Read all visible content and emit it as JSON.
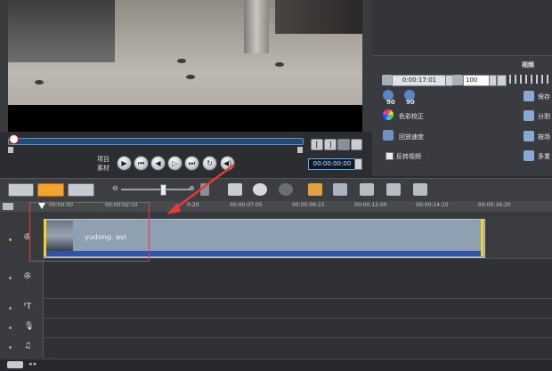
{
  "preview": {
    "label_project": "项目",
    "label_clip": "素材",
    "timecode": "00:00:00:00",
    "buttons": [
      "play-icon",
      "to-start-icon",
      "prev-frame-icon",
      "next-frame-icon",
      "to-end-icon",
      "repeat-icon",
      "volume-icon"
    ],
    "trim_buttons": [
      "[",
      "]"
    ]
  },
  "options_panel": {
    "tab_video": "视频",
    "duration": "0:00:17:01",
    "volume": "100",
    "rotate_left_label": "90",
    "rotate_right_label": "90",
    "color_correction": "色彩校正",
    "playback_speed": "回放速度",
    "reverse_video": "反转视频",
    "save": "保存",
    "split": "分割",
    "scan": "按场",
    "multi": "多重"
  },
  "timeline": {
    "ruler_ticks": [
      "00:00:00:00",
      "00:00:02:10",
      "00:00:04:20",
      "00:00:07:05",
      "00:00:09:15",
      "00:00:12:00",
      "00:00:14:10",
      "00:00:16:20"
    ],
    "ruler_visible": [
      "00:00:00",
      "00:00:02:10",
      "0:20",
      "00:00:07:05",
      "00:00:09:15",
      "00:00:12:00",
      "00:00:14:10",
      "00:00:16:20"
    ],
    "clip_name": "yudong. avi",
    "tracks": [
      "video-track",
      "overlay-track",
      "title-track",
      "voice-track",
      "music-track"
    ]
  },
  "colors": {
    "accent_scrub": "#1f4a7a",
    "clip_body": "#8fa0b2",
    "clip_band": "#2f55a8",
    "clip_edge": "#f5d21c",
    "annotation": "#e53a3a"
  }
}
